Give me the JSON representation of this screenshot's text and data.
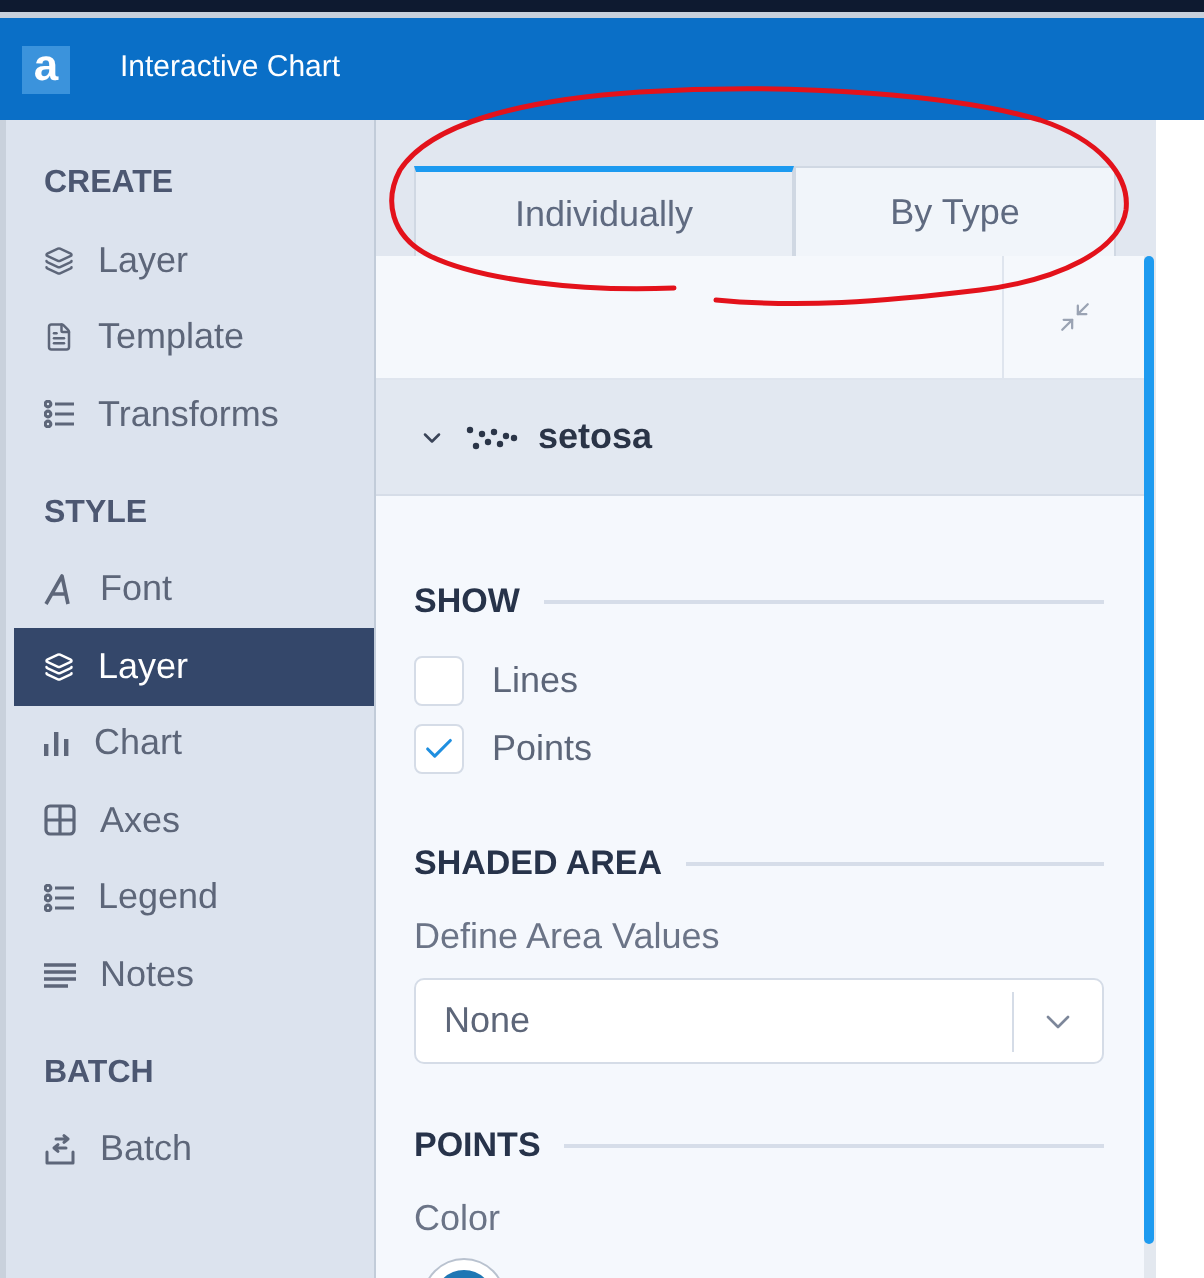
{
  "window": {
    "logo": "a",
    "title": "Interactive Chart"
  },
  "sidebar": {
    "sections": [
      {
        "title": "CREATE",
        "items": [
          {
            "label": "Layer",
            "selected": false
          },
          {
            "label": "Template",
            "selected": false
          },
          {
            "label": "Transforms",
            "selected": false
          }
        ]
      },
      {
        "title": "STYLE",
        "items": [
          {
            "label": "Font",
            "selected": false
          },
          {
            "label": "Layer",
            "selected": true
          },
          {
            "label": "Chart",
            "selected": false
          },
          {
            "label": "Axes",
            "selected": false
          },
          {
            "label": "Legend",
            "selected": false
          },
          {
            "label": "Notes",
            "selected": false
          }
        ]
      },
      {
        "title": "BATCH",
        "items": [
          {
            "label": "Batch",
            "selected": false
          }
        ]
      }
    ]
  },
  "tabs": [
    {
      "label": "Individually",
      "selected": true
    },
    {
      "label": "By Type",
      "selected": false
    }
  ],
  "layer": {
    "name": "setosa",
    "expanded": true
  },
  "sections": [
    {
      "title": "SHOW",
      "fields": [
        {
          "kind": "checkbox",
          "label": "Lines",
          "checked": false
        },
        {
          "kind": "checkbox",
          "label": "Points",
          "checked": true
        }
      ]
    },
    {
      "title": "SHADED AREA",
      "fields": [
        {
          "kind": "select",
          "label": "Define Area Values",
          "value": "None"
        }
      ]
    },
    {
      "title": "POINTS",
      "fields": [
        {
          "kind": "color",
          "label": "Color",
          "color": "#1f77b4"
        }
      ]
    }
  ],
  "annotation": {
    "kind": "ellipse"
  }
}
